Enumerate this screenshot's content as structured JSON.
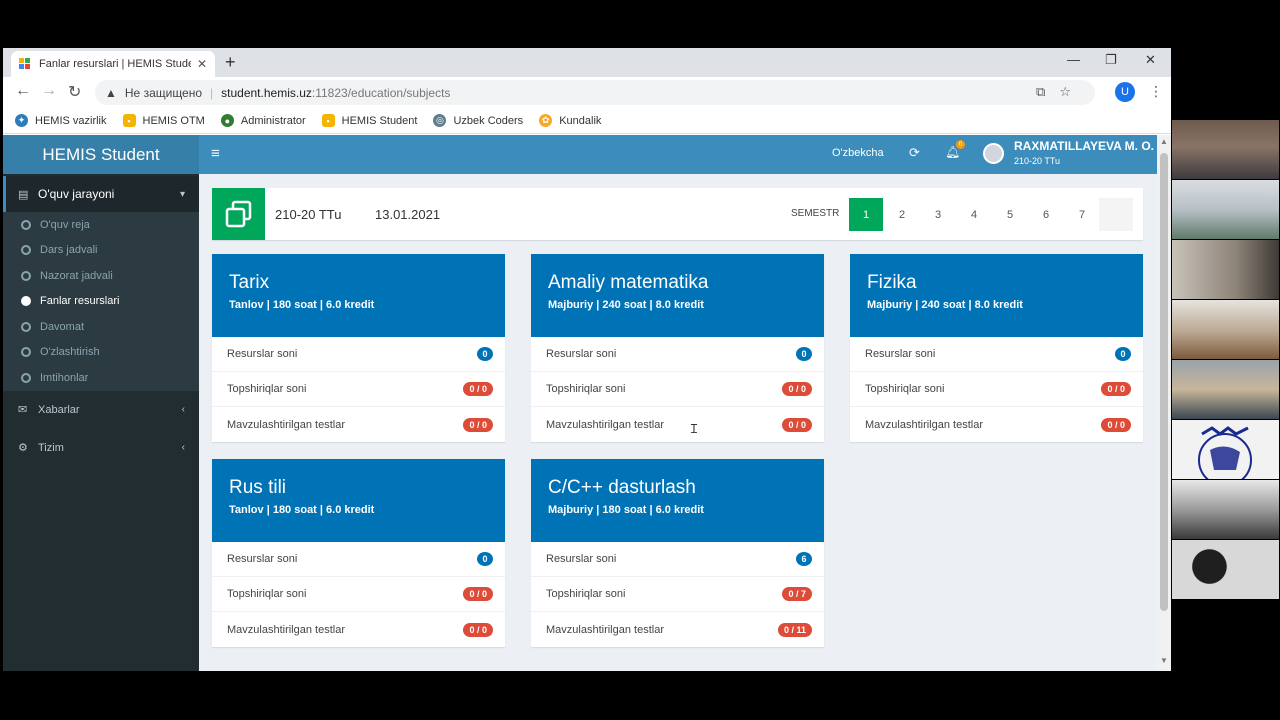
{
  "browser": {
    "tab_title": "Fanlar resurslari | HEMIS Student",
    "new_tab": "+",
    "controls": {
      "minimize": "—",
      "maximize": "❐",
      "close": "✕"
    },
    "address": {
      "security": "Не защищено",
      "host": "student.hemis.uz",
      "path": ":11823/education/subjects"
    },
    "profile_initial": "U",
    "bookmarks": [
      {
        "label": "HEMIS vazirlik",
        "icon": "hemis-vazirlik-icon",
        "color": "#2e7dba"
      },
      {
        "label": "HEMIS OTM",
        "icon": "hemis-otm-icon",
        "color": "#f4b400"
      },
      {
        "label": "Administrator",
        "icon": "administrator-icon",
        "color": "#2e7d32"
      },
      {
        "label": "HEMIS Student",
        "icon": "hemis-student-icon",
        "color": "#f4b400"
      },
      {
        "label": "Uzbek Coders",
        "icon": "uzbek-coders-icon",
        "color": "#607d8b"
      },
      {
        "label": "Kundalik",
        "icon": "kundalik-icon",
        "color": "#f9a825"
      }
    ]
  },
  "app": {
    "brand": "HEMIS Student",
    "topnav": {
      "language": "O'zbekcha",
      "notif_count": "0",
      "user_name": "RAXMATILLAYEVA M. O.",
      "user_group": "210-20 TTu"
    },
    "sidebar": {
      "section_active": "O'quv jarayoni",
      "subitems": [
        {
          "label": "O'quv reja",
          "current": false
        },
        {
          "label": "Dars jadvali",
          "current": false
        },
        {
          "label": "Nazorat jadvali",
          "current": false
        },
        {
          "label": "Fanlar resurslari",
          "current": true
        },
        {
          "label": "Davomat",
          "current": false
        },
        {
          "label": "O'zlashtirish",
          "current": false
        },
        {
          "label": "Imtihonlar",
          "current": false
        }
      ],
      "sections": [
        {
          "label": "Xabarlar",
          "icon": "envelope-icon"
        },
        {
          "label": "Tizim",
          "icon": "gear-icon"
        }
      ]
    },
    "info": {
      "group": "210-20 TTu",
      "date": "13.01.2021",
      "semester_label": "SEMESTR",
      "semesters": [
        "1",
        "2",
        "3",
        "4",
        "5",
        "6",
        "7"
      ],
      "active_semester": "1"
    },
    "row_labels": {
      "resources": "Resurslar soni",
      "assignments": "Topshiriqlar soni",
      "tests": "Mavzulashtirilgan testlar"
    },
    "subjects": [
      {
        "name": "Tarix",
        "meta": "Tanlov | 180 soat | 6.0 kredit",
        "resources": "0",
        "assignments": "0 / 0",
        "tests": "0 / 0"
      },
      {
        "name": "Amaliy matematika",
        "meta": "Majburiy | 240 soat | 8.0 kredit",
        "resources": "0",
        "assignments": "0 / 0",
        "tests": "0 / 0"
      },
      {
        "name": "Fizika",
        "meta": "Majburiy | 240 soat | 8.0 kredit",
        "resources": "0",
        "assignments": "0 / 0",
        "tests": "0 / 0"
      },
      {
        "name": "Rus tili",
        "meta": "Tanlov | 180 soat | 6.0 kredit",
        "resources": "0",
        "assignments": "0 / 0",
        "tests": "0 / 0"
      },
      {
        "name": "C/C++ dasturlash",
        "meta": "Majburiy | 180 soat | 6.0 kredit",
        "resources": "6",
        "assignments": "0 / 7",
        "tests": "0 / 11"
      }
    ]
  },
  "colors": {
    "brand_blue": "#3c8dbc",
    "card_head": "#0073b7",
    "success": "#00a65a",
    "danger": "#dd4b39",
    "sidebar": "#222d32"
  }
}
